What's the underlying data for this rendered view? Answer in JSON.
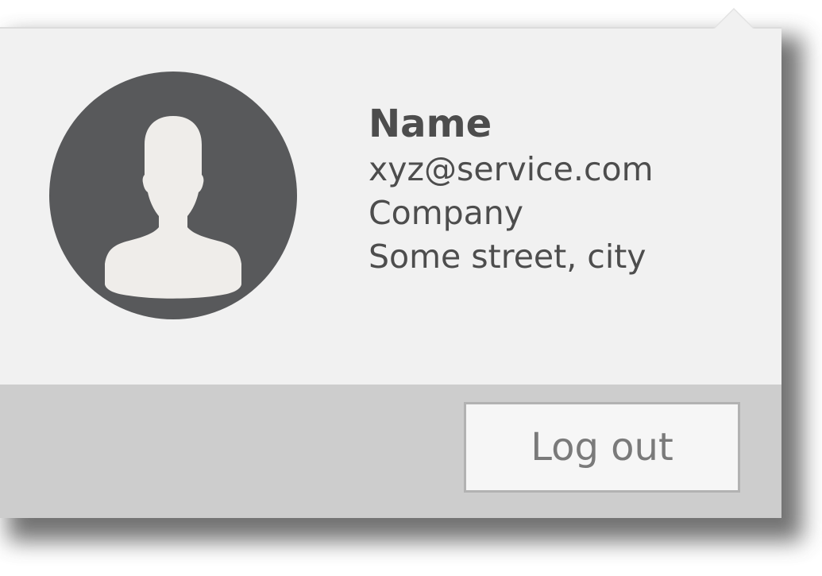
{
  "profile": {
    "name": "Name",
    "email": "xyz@service.com",
    "company": "Company",
    "address": "Some street, city"
  },
  "footer": {
    "logout_label": "Log out"
  },
  "icons": {
    "avatar": "user-silhouette-icon"
  },
  "colors": {
    "panel": "#f1f1f1",
    "footer": "#cdcdcd",
    "avatar_bg": "#58595b",
    "avatar_fg": "#efedea",
    "button_bg": "#f6f6f6",
    "button_border": "#b2b2b2"
  }
}
